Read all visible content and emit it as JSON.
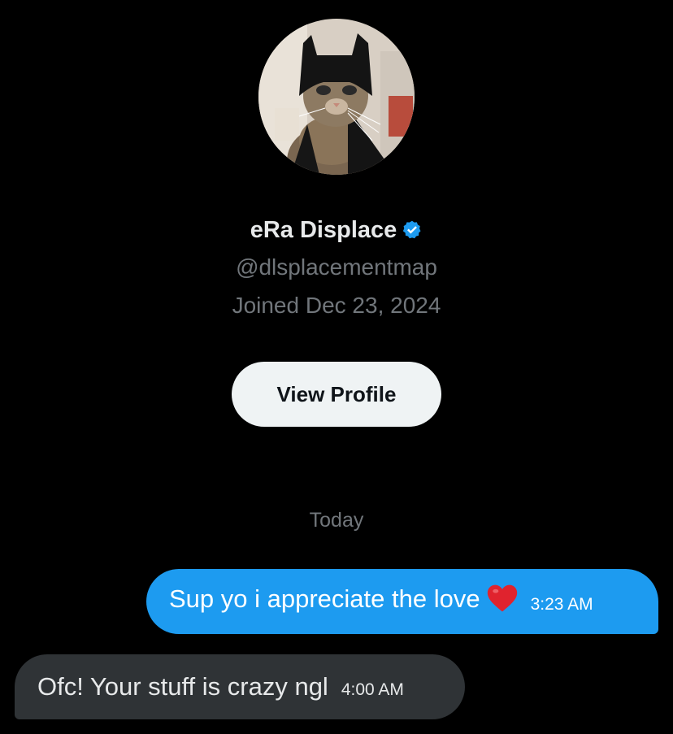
{
  "profile": {
    "display_name": "eRa Displace",
    "handle": "@dlsplacementmap",
    "joined": "Joined Dec 23, 2024",
    "verified": true,
    "avatar_icon": "cat-in-batman-mask",
    "view_profile_label": "View Profile"
  },
  "conversation": {
    "date_divider": "Today",
    "messages": [
      {
        "direction": "sent",
        "text": "Sup yo i appreciate the love",
        "emoji": "red-heart",
        "time": "3:23 AM"
      },
      {
        "direction": "received",
        "text": "Ofc! Your stuff is crazy ngl",
        "time": "4:00 AM"
      }
    ]
  },
  "colors": {
    "background": "#000000",
    "sent_bubble": "#1d9bf0",
    "received_bubble": "#2f3336",
    "secondary_text": "#71767b",
    "verified_badge": "#1d9bf0",
    "button_bg": "#eff3f4"
  }
}
